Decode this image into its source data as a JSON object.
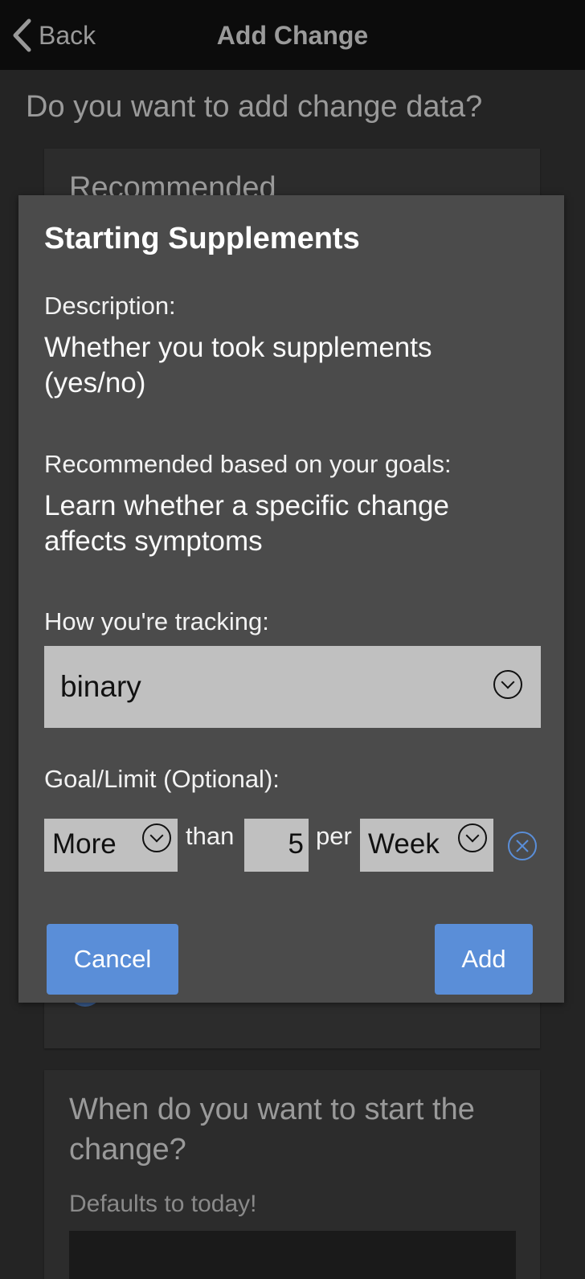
{
  "navbar": {
    "back_label": "Back",
    "title": "Add Change"
  },
  "page": {
    "question": "Do you want to add change data?"
  },
  "card_recommended": {
    "heading": "Recommended"
  },
  "card_start": {
    "question": "When do you want to start the change?",
    "hint": "Defaults to today!"
  },
  "modal": {
    "title": "Starting Supplements",
    "description_label": "Description:",
    "description_value": "Whether you took supplements (yes/no)",
    "goals_label": "Recommended based on your goals:",
    "goals_value": "Learn whether a specific change affects symptoms",
    "tracking_label": "How you're tracking:",
    "tracking_value": "binary",
    "goal_label": "Goal/Limit (Optional):",
    "goal": {
      "direction": "More",
      "than_label": "than",
      "amount": "5",
      "per_label": "per",
      "period": "Week"
    },
    "cancel_label": "Cancel",
    "add_label": "Add"
  },
  "colors": {
    "background": "#242424",
    "modal": "#4b4b4b",
    "button": "#5a8ed8",
    "select": "#c0c0c0",
    "clear_icon": "#5a8ed8"
  },
  "icons": [
    "back-chevron-icon",
    "chevron-down-icon",
    "clear-circle-icon"
  ]
}
